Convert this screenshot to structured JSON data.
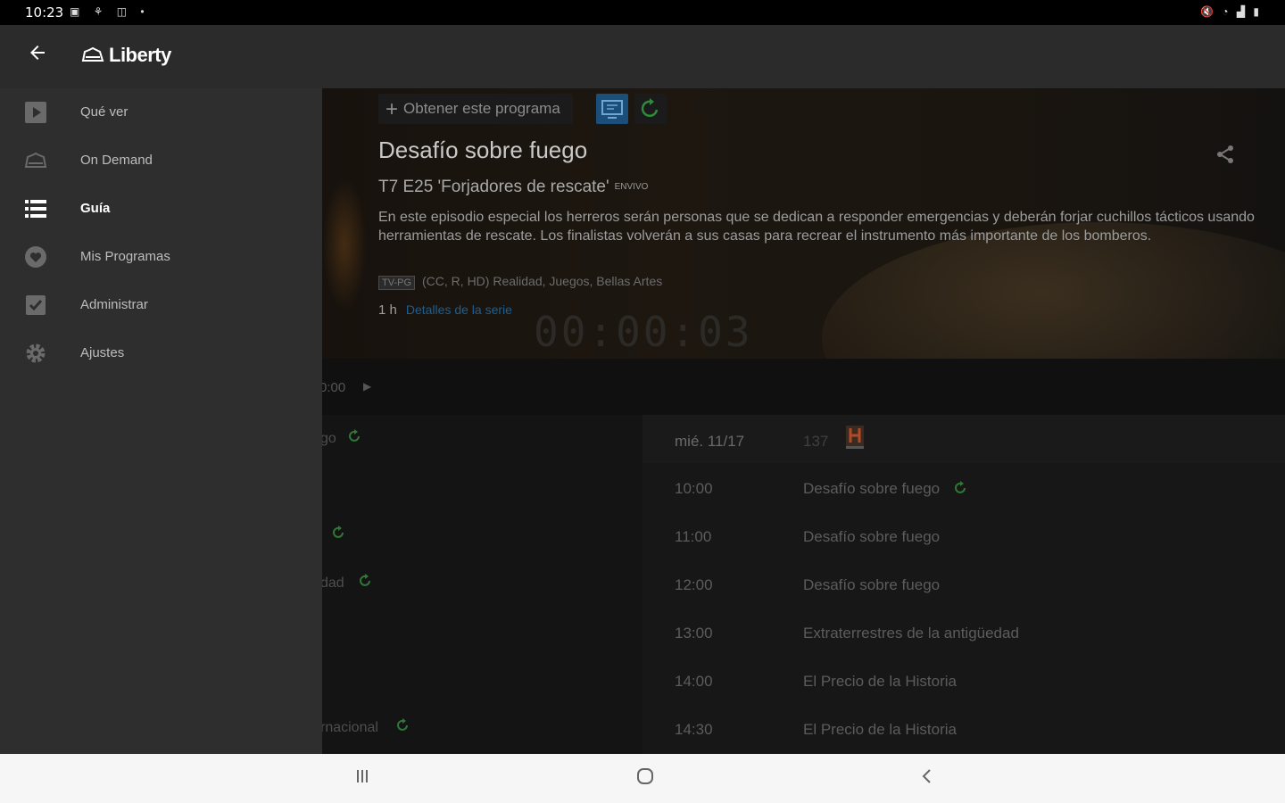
{
  "status_bar": {
    "time": "10:23"
  },
  "app_bar": {
    "logo_text": "Liberty"
  },
  "nav": {
    "items": [
      {
        "label": "Qué ver",
        "icon": "play-icon",
        "active": false
      },
      {
        "label": "On Demand",
        "icon": "on-demand-icon",
        "active": false
      },
      {
        "label": "Guía",
        "icon": "list-icon",
        "active": true
      },
      {
        "label": "Mis Programas",
        "icon": "heart-icon",
        "active": false
      },
      {
        "label": "Administrar",
        "icon": "checkbox-icon",
        "active": false
      },
      {
        "label": "Ajustes",
        "icon": "gear-icon",
        "active": false
      }
    ]
  },
  "program": {
    "get_program_label": "Obtener este programa",
    "title": "Desafío sobre fuego",
    "episode": "T7 E25 'Forjadores de rescate'",
    "live_badge": "ENVIVO",
    "description": "En este episodio especial los herreros serán personas que se dedican a responder emergencias y deberán forjar cuchillos tácticos usando herramientas de rescate. Los finalistas volverán a sus casas para recrear el instrumento más importante de los bomberos.",
    "rating": "TV-PG",
    "meta": "(CC, R, HD) Realidad, Juegos, Bellas Artes",
    "duration": "1 h",
    "series_link": "Detalles de la serie",
    "timer": "00:00:03"
  },
  "guide": {
    "time_label": "0:00",
    "left_rows": [
      "go",
      "",
      "",
      "dad",
      "",
      "",
      "rnacional"
    ],
    "date": "mié. 11/17",
    "channel": "137",
    "schedule": [
      {
        "time": "10:00",
        "program": "Desafío sobre fuego"
      },
      {
        "time": "11:00",
        "program": "Desafío sobre fuego"
      },
      {
        "time": "12:00",
        "program": "Desafío sobre fuego"
      },
      {
        "time": "13:00",
        "program": "Extraterrestres de la antigüedad"
      },
      {
        "time": "14:00",
        "program": "El Precio de la Historia"
      },
      {
        "time": "14:30",
        "program": "El Precio de la Historia"
      }
    ]
  },
  "colors": {
    "accent_blue": "#1c4e7a",
    "record_green": "#2e8b3a",
    "drawer_bg": "#2e2e2e"
  }
}
